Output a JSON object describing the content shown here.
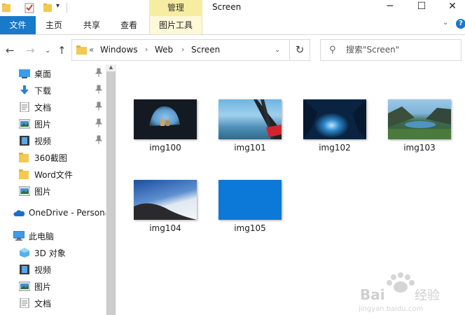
{
  "titlebar": {
    "title": "Screen",
    "context_tab": "管理"
  },
  "ribbon": {
    "file": "文件",
    "tabs": [
      "主页",
      "共享",
      "查看"
    ],
    "context_tab": "图片工具",
    "help": "?"
  },
  "address": {
    "overflow": "«",
    "crumbs": [
      "Windows",
      "Web",
      "Screen"
    ]
  },
  "search": {
    "placeholder": "搜索\"Screen\""
  },
  "nav": {
    "quick_access": [
      {
        "label": "桌面",
        "icon": "desktop-icon",
        "pinned": true
      },
      {
        "label": "下载",
        "icon": "download-icon",
        "pinned": true
      },
      {
        "label": "文档",
        "icon": "documents-icon",
        "pinned": true
      },
      {
        "label": "图片",
        "icon": "pictures-icon",
        "pinned": true
      },
      {
        "label": "视频",
        "icon": "videos-icon",
        "pinned": true
      },
      {
        "label": "360截图",
        "icon": "folder-icon",
        "pinned": false
      },
      {
        "label": "Word文件",
        "icon": "folder-icon",
        "pinned": false
      },
      {
        "label": "图片",
        "icon": "pictures-icon",
        "pinned": false
      }
    ],
    "onedrive": "OneDrive - Persona",
    "this_pc": "此电脑",
    "this_pc_items": [
      {
        "label": "3D 对象",
        "icon": "3d-objects-icon"
      },
      {
        "label": "视频",
        "icon": "videos-icon"
      },
      {
        "label": "图片",
        "icon": "pictures-icon"
      },
      {
        "label": "文档",
        "icon": "documents-icon"
      }
    ]
  },
  "files": [
    {
      "name": "img100"
    },
    {
      "name": "img101"
    },
    {
      "name": "img102"
    },
    {
      "name": "img103"
    },
    {
      "name": "img104"
    },
    {
      "name": "img105"
    }
  ],
  "colors": {
    "accent": "#1979ca",
    "context_tab": "#f7eda2"
  }
}
